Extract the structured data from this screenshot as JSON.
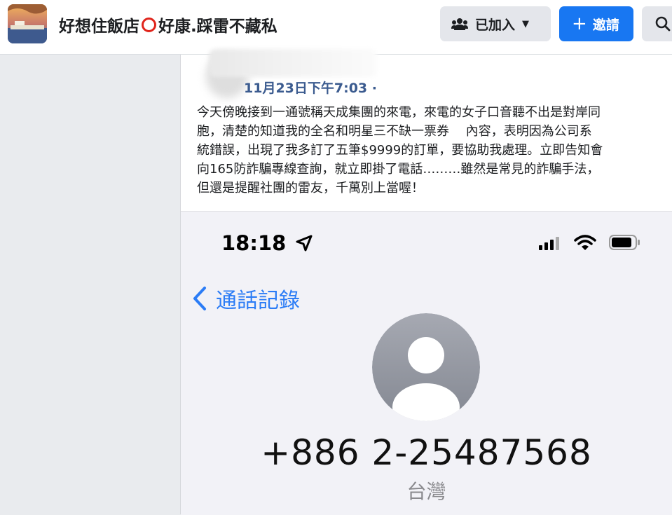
{
  "group": {
    "name_part1": "好想住飯店",
    "name_part2": "好康.踩雷不藏私",
    "joined_label": "已加入",
    "invite_label": "邀請"
  },
  "icons": {
    "group_avatar": "group-cover-photo",
    "joined": "people-icon",
    "caret": "caret-down-icon",
    "invite": "plus-icon",
    "search": "search-icon"
  },
  "colors": {
    "invite_button": "#1877f2",
    "timestamp": "#3b5b8f",
    "ios_link": "#2b7cf6"
  },
  "post": {
    "timestamp": "11月23日下午7:03 ·",
    "body": "今天傍晚接到一通號稱天成集團的來電，來電的女子口音聽不出是對岸同\n胞，清楚的知道我的全名和明星三不缺一票券　 內容，表明因為公司系\n統錯誤，出現了我多訂了五筆$9999的訂單，要協助我處理。立即告知會\n向165防詐騙專線查詢，就立即掛了電話………雖然是常見的詐騙手法，\n但還是提醒社團的雷友，千萬別上當喔！"
  },
  "phone_screen": {
    "status_time": "18:18",
    "back_label": "通話記錄",
    "caller_number": "+886 2-25487568",
    "caller_location": "台灣"
  }
}
